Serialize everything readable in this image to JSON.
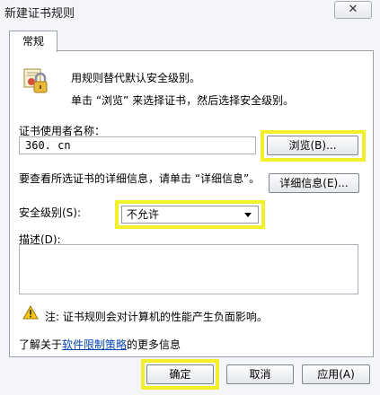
{
  "window": {
    "title": "新建证书规则",
    "close_label": "✕"
  },
  "tabs": [
    {
      "label": "常规"
    }
  ],
  "general": {
    "description_line1": "用规则替代默认安全级别。",
    "description_line2": "单击 “浏览” 来选择证书，然后选择安全级别。",
    "cert_user_label": "证书使用者名称：",
    "cert_user_value": "360. cn",
    "browse_button": "浏览(B)...",
    "details_prompt": "要查看所选证书的详细信息，请单击 “详细信息”。",
    "details_button": "详细信息(E)...",
    "security_level_label": "安全级别(S):",
    "security_level_value": "不允许",
    "desc_label": "描述(D):",
    "desc_value": "",
    "warning_text": "注: 证书规则会对计算机的性能产生负面影响。",
    "more_info_prefix": "了解关于",
    "more_info_link": "软件限制策略",
    "more_info_suffix": "的更多信息"
  },
  "footer": {
    "ok_button": "确定",
    "cancel_button": "取消",
    "apply_button": "应用(A)"
  },
  "icons": {
    "certificate": "certificate-lock-icon",
    "warning": "warning-icon",
    "dropdown": "chevron-down-icon",
    "close": "close-icon"
  },
  "colors": {
    "highlight": "#f2f02a",
    "link": "#0645ad"
  }
}
